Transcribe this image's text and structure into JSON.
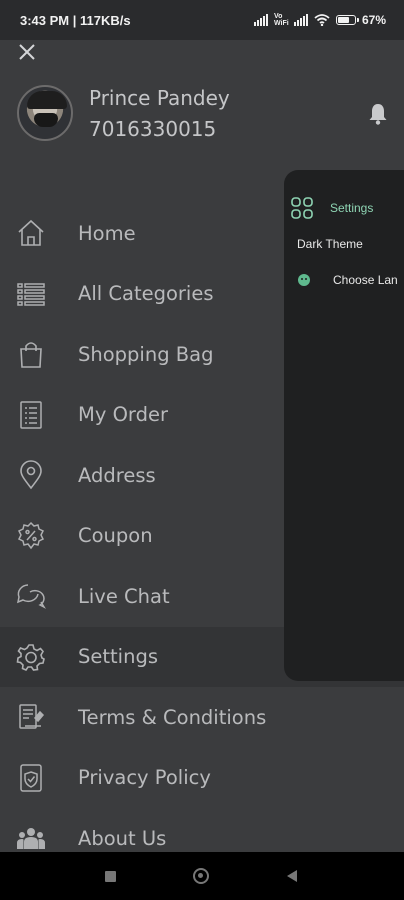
{
  "status_bar": {
    "time_speed": "3:43 PM | 117KB/s",
    "vowifi": "Vo WiFi",
    "battery": "67%"
  },
  "profile": {
    "name": "Prince Pandey",
    "phone": "7016330015"
  },
  "menu": {
    "items": [
      {
        "label": "Home",
        "icon": "home-icon"
      },
      {
        "label": "All Categories",
        "icon": "list-icon"
      },
      {
        "label": "Shopping Bag",
        "icon": "shopping-bag-icon"
      },
      {
        "label": "My Order",
        "icon": "document-icon"
      },
      {
        "label": "Address",
        "icon": "location-pin-icon"
      },
      {
        "label": "Coupon",
        "icon": "coupon-icon"
      },
      {
        "label": "Live Chat",
        "icon": "chat-icon"
      },
      {
        "label": "Settings",
        "icon": "gear-icon",
        "active": true
      },
      {
        "label": "Terms & Conditions",
        "icon": "terms-icon"
      },
      {
        "label": "Privacy Policy",
        "icon": "privacy-icon"
      },
      {
        "label": "About Us",
        "icon": "people-icon"
      }
    ]
  },
  "settings_panel": {
    "title": "Settings",
    "dark_theme": "Dark Theme",
    "choose_language": "Choose Lan"
  },
  "colors": {
    "drawer_bg": "#3b3c3e",
    "panel_bg": "#1f2021",
    "accent": "#8fd5b4",
    "active_row": "#333436"
  }
}
